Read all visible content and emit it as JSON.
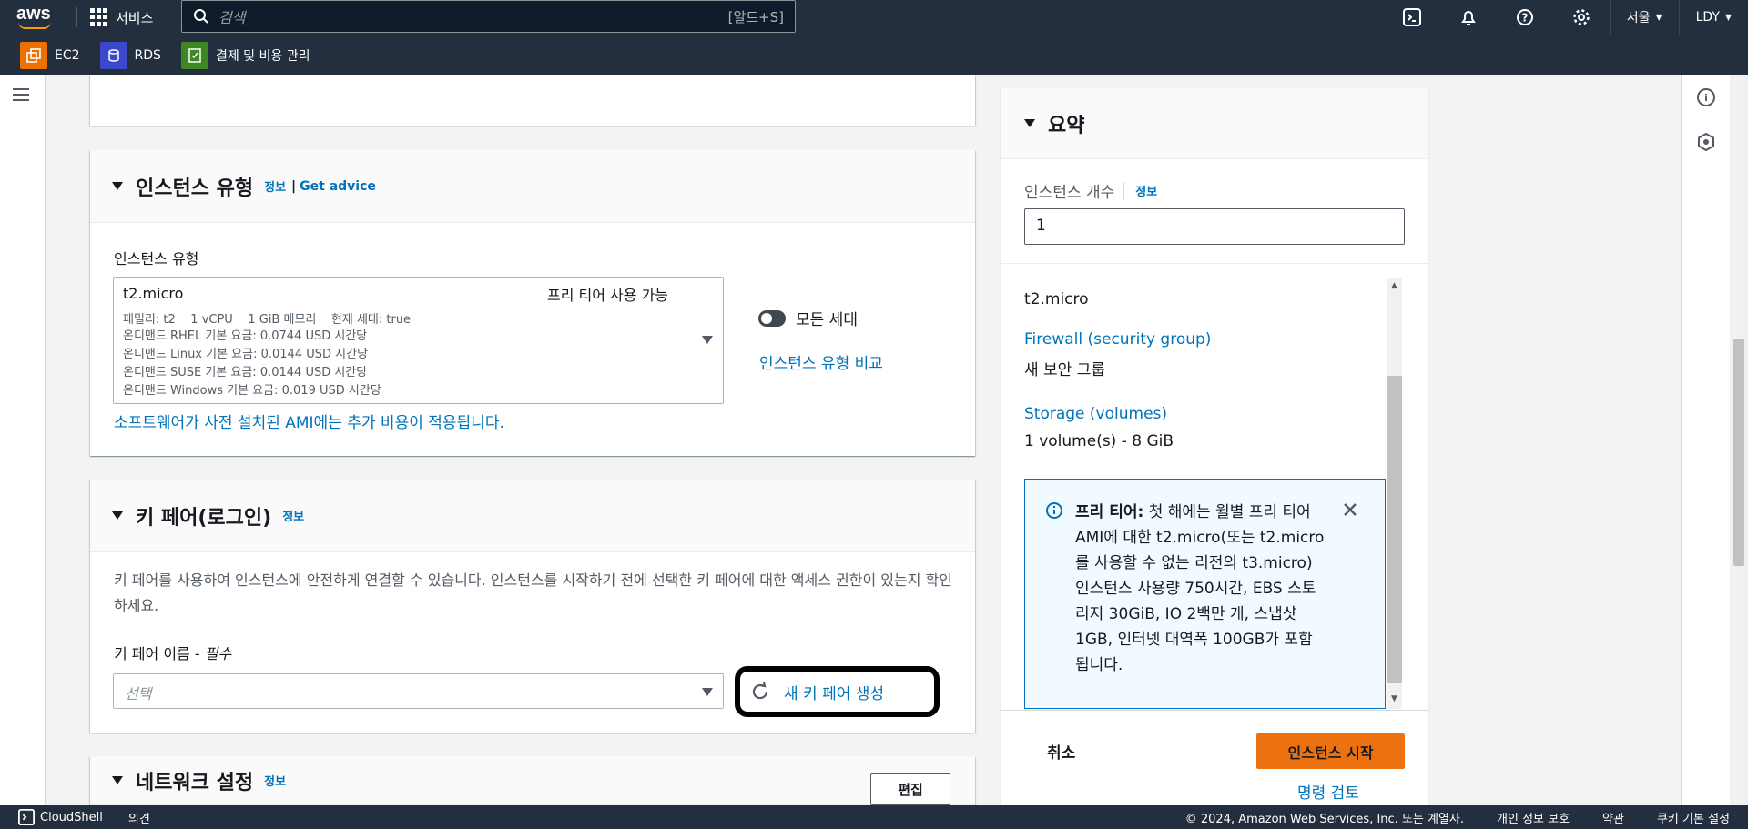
{
  "topnav": {
    "logo": "aws",
    "services_label": "서비스",
    "search_placeholder": "검색",
    "search_shortcut": "[알트+S]",
    "region": "서울",
    "user": "LDY"
  },
  "favorites": [
    {
      "label": "EC2",
      "color": "#ed7100",
      "icon": "ec2-icon"
    },
    {
      "label": "RDS",
      "color": "#3b48cc",
      "icon": "rds-icon"
    },
    {
      "label": "결제 및 비용 관리",
      "color": "#3f8624",
      "icon": "billing-icon"
    }
  ],
  "instance_type": {
    "title": "인스턴스 유형",
    "info": "정보",
    "separator": "|",
    "advice": "Get advice",
    "field_label": "인스턴스 유형",
    "selected": "t2.micro",
    "free_tier": "프리 티어 사용 가능",
    "details": "패밀리: t2    1 vCPU    1 GiB 메모리    현재 세대: true",
    "prices": [
      "온디맨드 RHEL 기본 요금: 0.0744 USD 시간당",
      "온디맨드 Linux 기본 요금: 0.0144 USD 시간당",
      "온디맨드 SUSE 기본 요금: 0.0144 USD 시간당",
      "온디맨드 Windows 기본 요금: 0.019 USD 시간당"
    ],
    "all_gen_label": "모든 세대",
    "compare_link": "인스턴스 유형 비교",
    "ami_note": "소프트웨어가 사전 설치된 AMI에는 추가 비용이 적용됩니다."
  },
  "key_pair": {
    "title": "키 페어(로그인)",
    "info": "정보",
    "description": "키 페어를 사용하여 인스턴스에 안전하게 연결할 수 있습니다. 인스턴스를 시작하기 전에 선택한 키 페어에 대한 액세스 권한이 있는지 확인하세요.",
    "field_label": "키 페어 이름 - ",
    "required": "필수",
    "placeholder": "선택",
    "create_button": "새 키 페어 생성"
  },
  "network": {
    "title": "네트워크 설정",
    "info": "정보",
    "edit_button": "편집"
  },
  "summary": {
    "title": "요약",
    "count_label": "인스턴스 개수",
    "info": "정보",
    "count_value": "1",
    "instance_type": "t2.micro",
    "firewall_link": "Firewall (security group)",
    "firewall_value": "새 보안 그룹",
    "storage_link": "Storage (volumes)",
    "storage_value": "1 volume(s) - 8 GiB",
    "free_tier_title": "프리 티어:",
    "free_tier_text": "첫 해에는 월별 프리 티어 AMI에 대한 t2.micro(또는 t2.micro를 사용할 수 없는 리전의 t3.micro) 인스턴스 사용량 750시간, EBS 스토리지 30GiB, IO 2백만 개, 스냅샷 1GB, 인터넷 대역폭 100GB가 포함됩니다.",
    "cancel": "취소",
    "launch": "인스턴스 시작",
    "review": "명령 검토"
  },
  "footer": {
    "cloudshell": "CloudShell",
    "feedback": "의견",
    "copyright": "© 2024, Amazon Web Services, Inc. 또는 계열사.",
    "privacy": "개인 정보 보호",
    "terms": "약관",
    "cookies": "쿠키 기본 설정"
  },
  "colors": {
    "nav": "#232f3e",
    "link": "#0073bb",
    "primary": "#ec7211"
  }
}
